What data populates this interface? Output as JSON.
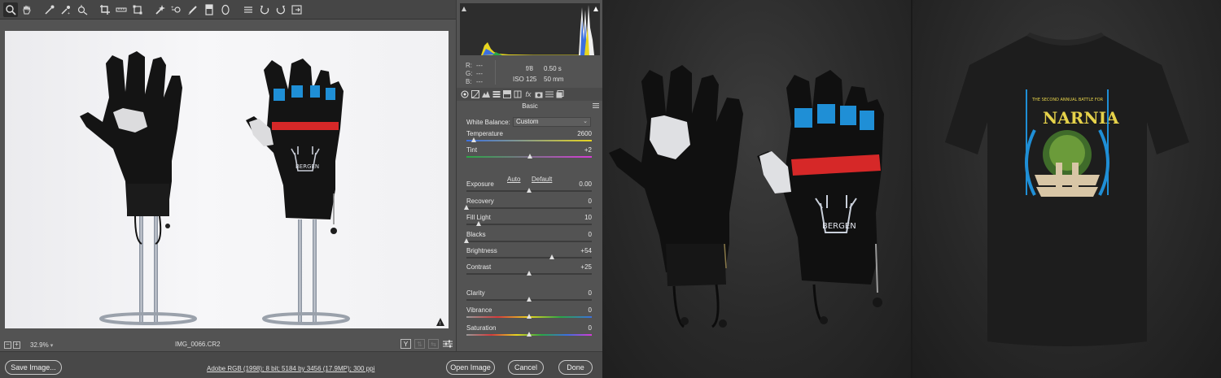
{
  "dialog": {
    "toolbar_tools": [
      "zoom-tool",
      "hand-tool",
      "white-balance-tool",
      "color-sampler-tool",
      "targeted-adjustment-tool",
      "crop-tool",
      "straighten-tool",
      "transform-tool",
      "spot-removal-tool",
      "red-eye-tool",
      "adjustment-brush",
      "graduated-filter",
      "radial-filter",
      "preferences",
      "rotate-left",
      "rotate-right"
    ],
    "status": {
      "zoom": "32.9%",
      "filename": "IMG_0066.CR2",
      "compare_label": "Y"
    },
    "readout": {
      "r_label": "R:",
      "g_label": "G:",
      "b_label": "B:",
      "r_value": "---",
      "g_value": "---",
      "b_value": "---",
      "aperture": "f/8",
      "shutter": "0.50 s",
      "iso": "ISO 125",
      "focal": "50 mm"
    },
    "panel": {
      "title": "Basic",
      "white_balance_label": "White Balance:",
      "white_balance_value": "Custom",
      "auto_label": "Auto",
      "default_label": "Default",
      "sliders": [
        {
          "label": "Temperature",
          "value": "2600",
          "pos": 0.06
        },
        {
          "label": "Tint",
          "value": "+2",
          "pos": 0.505
        },
        {
          "label": "Exposure",
          "value": "0.00",
          "pos": 0.5
        },
        {
          "label": "Recovery",
          "value": "0",
          "pos": 0.0
        },
        {
          "label": "Fill Light",
          "value": "10",
          "pos": 0.1
        },
        {
          "label": "Blacks",
          "value": "0",
          "pos": 0.0
        },
        {
          "label": "Brightness",
          "value": "+54",
          "pos": 0.685
        },
        {
          "label": "Contrast",
          "value": "+25",
          "pos": 0.5
        },
        {
          "label": "Clarity",
          "value": "0",
          "pos": 0.5
        },
        {
          "label": "Vibrance",
          "value": "0",
          "pos": 0.5
        },
        {
          "label": "Saturation",
          "value": "0",
          "pos": 0.5
        }
      ]
    },
    "footer": {
      "save_label": "Save Image...",
      "workflow_label": "Adobe RGB (1998); 8 bit; 5184 by 3456 (17.9MP); 300 ppi",
      "open_label": "Open Image",
      "cancel_label": "Cancel",
      "done_label": "Done"
    }
  },
  "glove_logo_text": "BERGEN",
  "tshirt_print": {
    "line1": "THE SECOND ANNUAL BATTLE FOR",
    "title": "NARNIA"
  },
  "colors": {
    "accent_blue": "#1f8fd6",
    "stripe_red": "#d62828",
    "panel_bg": "#535353"
  }
}
